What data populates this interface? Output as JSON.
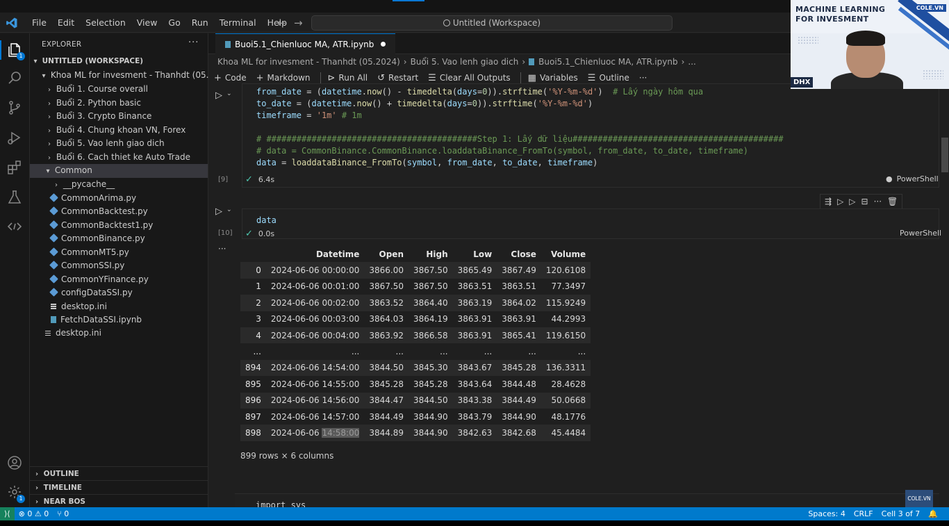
{
  "menu": [
    "File",
    "Edit",
    "Selection",
    "View",
    "Go",
    "Run",
    "Terminal",
    "Help"
  ],
  "command_center": "Untitled (Workspace)",
  "sidebar": {
    "title": "EXPLORER",
    "more": "···",
    "workspace": "UNTITLED (WORKSPACE)",
    "root": "Khoa ML for invesment - Thanhdt (05.2024)",
    "folders": [
      "Buổi 1. Course overall",
      "Buổi 2. Python basic",
      "Buổi 3. Crypto Binance",
      "Buổi 4. Chung khoan VN, Forex",
      "Buổi 5. Vao lenh giao dich",
      "Buổi 6. Cach thiet ke Auto Trade"
    ],
    "common_folder": "Common",
    "common_items": [
      {
        "name": "__pycache__",
        "type": "folder"
      },
      {
        "name": "CommonArima.py",
        "type": "py"
      },
      {
        "name": "CommonBacktest.py",
        "type": "py"
      },
      {
        "name": "CommonBacktest1.py",
        "type": "py"
      },
      {
        "name": "CommonBinance.py",
        "type": "py"
      },
      {
        "name": "CommonMT5.py",
        "type": "py"
      },
      {
        "name": "CommonSSI.py",
        "type": "py"
      },
      {
        "name": "CommonYFinance.py",
        "type": "py"
      },
      {
        "name": "configDataSSI.py",
        "type": "py"
      },
      {
        "name": "desktop.ini",
        "type": "ini"
      },
      {
        "name": "FetchDataSSI.ipynb",
        "type": "nb"
      }
    ],
    "root_file": "desktop.ini",
    "sections": [
      "OUTLINE",
      "TIMELINE",
      "NEAR BOS"
    ]
  },
  "editor": {
    "tab": "Buoi5.1_Chienluoc MA, ATR.ipynb",
    "breadcrumb": [
      "Khoa ML for invesment - Thanhdt (05.2024)",
      "Buổi 5. Vao lenh giao dich",
      "Buoi5.1_Chienluoc MA, ATR.ipynb",
      "..."
    ],
    "toolbar": [
      "Code",
      "Markdown",
      "Run All",
      "Restart",
      "Clear All Outputs",
      "Variables",
      "Outline",
      "···"
    ],
    "cell1": {
      "lines": [
        "from_date = (datetime.now() - timedelta(days=0)).strftime('%Y-%m-%d')  # Lấy ngày hôm qua",
        "to_date = (datetime.now() + timedelta(days=0)).strftime('%Y-%m-%d')",
        "timeframe = '1m' # 1m",
        "",
        "# ##########################################Step 1: Lấy dữ liệu##########################################",
        "# data = CommonBinance.CommonBinance.loaddataBinance_FromTo(symbol, from_date, to_date, timeframe)",
        "data = loaddataBinance_FromTo(symbol, from_date, to_date, timeframe)"
      ],
      "exec_count": "[9]",
      "duration": "6.4s",
      "kernel": "PowerShell"
    },
    "cell2": {
      "code": "data",
      "exec_count": "[10]",
      "duration": "0.0s",
      "kernel": "PowerShell"
    },
    "output_more": "···",
    "dataframe": {
      "columns": [
        "",
        "Datetime",
        "Open",
        "High",
        "Low",
        "Close",
        "Volume"
      ],
      "rows": [
        [
          "0",
          "2024-06-06 00:00:00",
          "3866.00",
          "3867.50",
          "3865.49",
          "3867.49",
          "120.6108"
        ],
        [
          "1",
          "2024-06-06 00:01:00",
          "3867.50",
          "3867.50",
          "3863.51",
          "3863.51",
          "77.3497"
        ],
        [
          "2",
          "2024-06-06 00:02:00",
          "3863.52",
          "3864.40",
          "3863.19",
          "3864.02",
          "115.9249"
        ],
        [
          "3",
          "2024-06-06 00:03:00",
          "3864.03",
          "3864.19",
          "3863.91",
          "3863.91",
          "44.2993"
        ],
        [
          "4",
          "2024-06-06 00:04:00",
          "3863.92",
          "3866.58",
          "3863.91",
          "3865.41",
          "119.6150"
        ],
        [
          "...",
          "...",
          "...",
          "...",
          "...",
          "...",
          "..."
        ],
        [
          "894",
          "2024-06-06 14:54:00",
          "3844.50",
          "3845.30",
          "3843.67",
          "3845.28",
          "136.3311"
        ],
        [
          "895",
          "2024-06-06 14:55:00",
          "3845.28",
          "3845.28",
          "3843.64",
          "3844.48",
          "28.4628"
        ],
        [
          "896",
          "2024-06-06 14:56:00",
          "3844.47",
          "3844.50",
          "3843.38",
          "3844.49",
          "50.0668"
        ],
        [
          "897",
          "2024-06-06 14:57:00",
          "3844.49",
          "3844.90",
          "3843.79",
          "3844.90",
          "48.1776"
        ],
        [
          "898",
          "2024-06-06 14:58:00",
          "3844.89",
          "3844.90",
          "3842.63",
          "3842.68",
          "45.4484"
        ]
      ],
      "shape": "899 rows × 6 columns"
    },
    "cell3_code": "import sys"
  },
  "statusbar": {
    "errors": "0",
    "warnings": "0",
    "ports": "0",
    "spaces": "Spaces: 4",
    "eol": "CRLF",
    "cell": "Cell 3 of 7"
  },
  "webcam": {
    "line1": "MACHINE LEARNING",
    "line2": "FOR INVESMENT",
    "logo": "COLE.VN",
    "tag": "DHX"
  },
  "watermark": "COLE.VN",
  "colors": {
    "accent": "#0078d4",
    "statusbar": "#007acc"
  }
}
